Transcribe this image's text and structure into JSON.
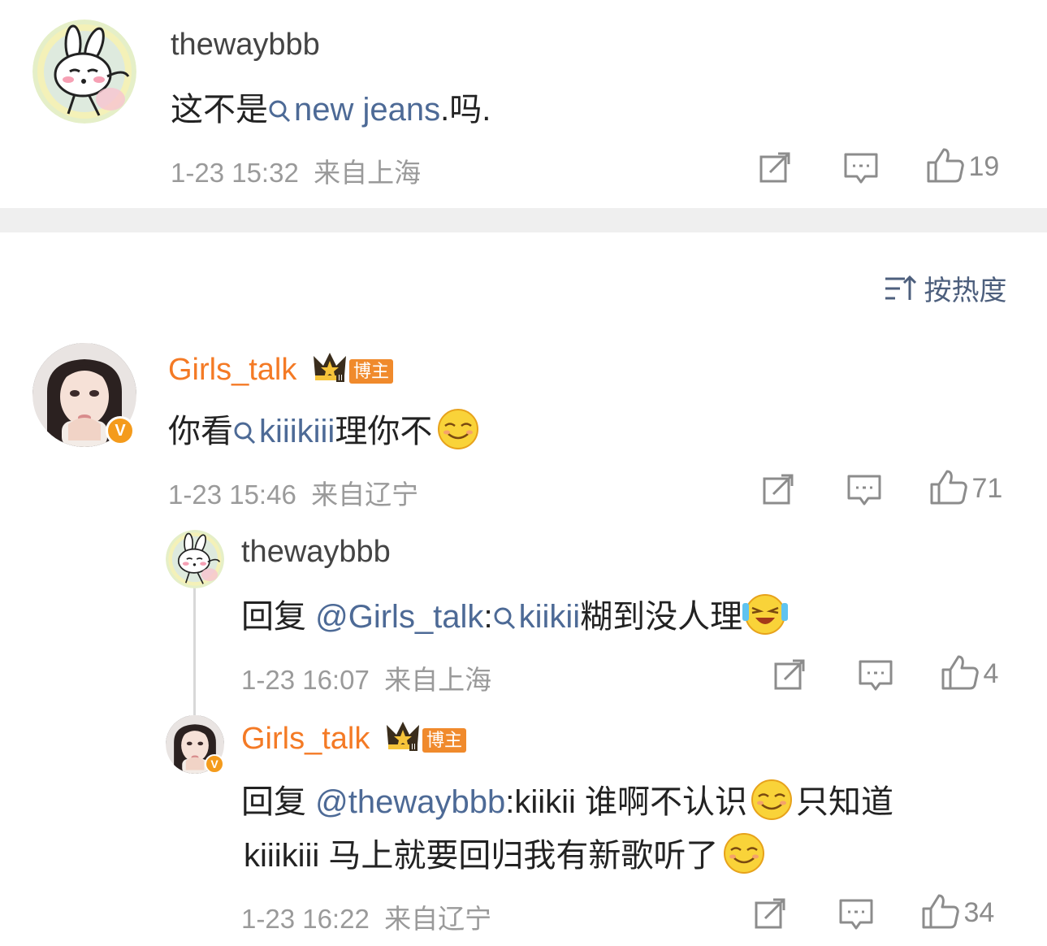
{
  "comments": [
    {
      "username": "thewaybbb",
      "text_prefix": "这不是",
      "link": "new jeans",
      "text_suffix": ".吗.",
      "time": "1-23 15:32",
      "location": "来自上海",
      "likes": "19"
    }
  ],
  "sort": {
    "label": "按热度"
  },
  "thread": {
    "main": {
      "username": "Girls_talk",
      "badge": "博主",
      "vbadge": "V",
      "text_prefix": "你看",
      "link": "kiiikiii",
      "text_suffix": "理你不",
      "time": "1-23 15:46",
      "location": "来自辽宁",
      "likes": "71"
    },
    "replies": [
      {
        "username": "thewaybbb",
        "reply_prefix": "回复",
        "mention": "@Girls_talk",
        "colon": ":",
        "link": "kiikii",
        "text_suffix": "糊到没人理",
        "time": "1-23 16:07",
        "location": "来自上海",
        "likes": "4"
      },
      {
        "username": "Girls_talk",
        "badge": "博主",
        "vbadge": "V",
        "reply_prefix": "回复",
        "mention": "@thewaybbb",
        "line1_text": ":kiikii 谁啊不认识",
        "line1_suffix": "只知道",
        "line2_text": "kiiikiii 马上就要回归我有新歌听了",
        "time": "1-23 16:22",
        "location": "来自辽宁",
        "likes": "34"
      }
    ]
  },
  "icons": {
    "repost": "repost-icon",
    "comment": "comment-icon",
    "like": "like-icon",
    "search": "search-icon",
    "sort": "sort-icon"
  },
  "colors": {
    "link": "#4d6a96",
    "orange_name": "#f47a25",
    "badge": "#f08a2c",
    "meta": "#9a9a9a"
  }
}
